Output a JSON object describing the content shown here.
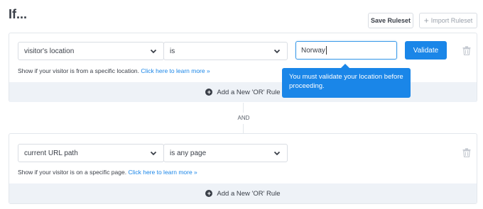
{
  "header": {
    "title": "If...",
    "save_ruleset": "Save Ruleset",
    "import_ruleset": "Import Ruleset"
  },
  "rule1": {
    "condition": "visitor's location",
    "operator": "is",
    "value": "Norway",
    "validate_label": "Validate",
    "help_text": "Show if your visitor is from a specific location.",
    "help_link": "Click here to learn more »",
    "add_or": "Add a New 'OR' Rule"
  },
  "tooltip": {
    "text": "You must validate your location before proceeding."
  },
  "connector": {
    "label": "AND"
  },
  "rule2": {
    "condition": "current URL path",
    "operator": "is any page",
    "help_text": "Show if your visitor is on a specific page.",
    "help_link": "Click here to learn more »",
    "add_or": "Add a New 'OR' Rule"
  },
  "colors": {
    "accent": "#1a86e8",
    "or_bar_bg": "#eef2f7",
    "border": "#e3e7ec"
  }
}
